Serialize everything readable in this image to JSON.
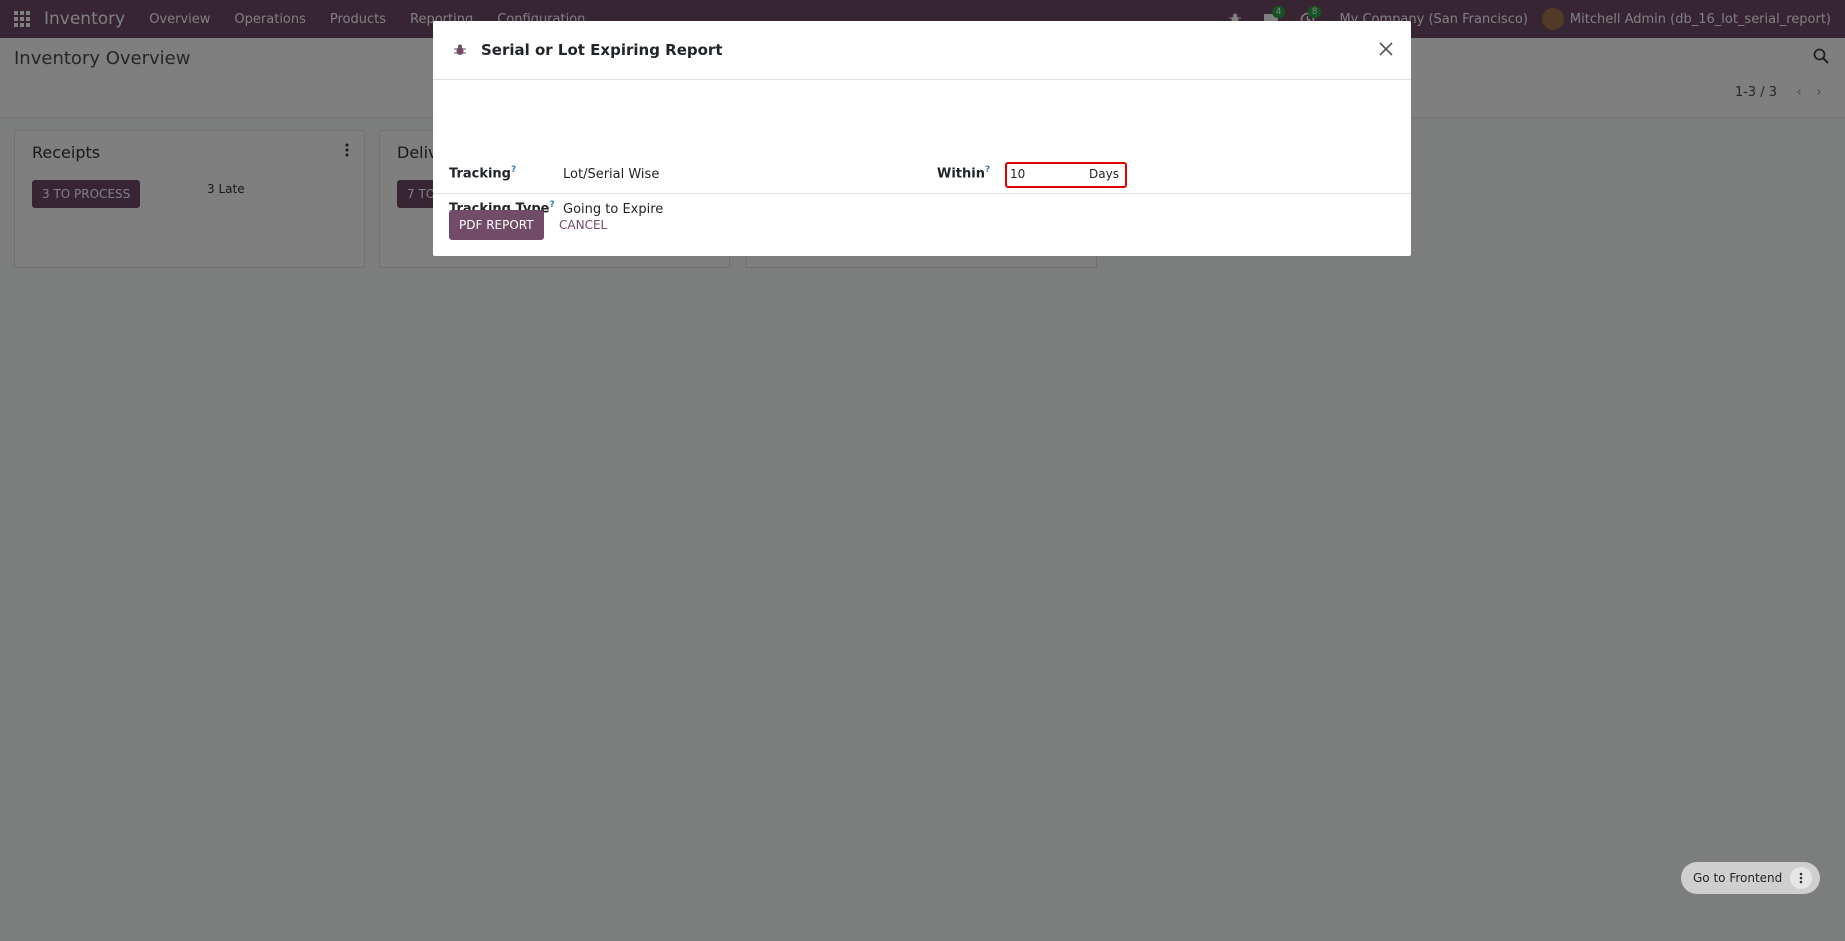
{
  "navbar": {
    "brand": "Inventory",
    "menu": [
      "Overview",
      "Operations",
      "Products",
      "Reporting",
      "Configuration"
    ],
    "messages_count": "4",
    "activities_count": "8",
    "company": "My Company (San Francisco)",
    "user": "Mitchell Admin (db_16_lot_serial_report)",
    "color": "#714b67"
  },
  "control_panel": {
    "title": "Inventory Overview",
    "pager": "1-3 / 3"
  },
  "cards": [
    {
      "title": "Receipts",
      "button": "3 TO PROCESS",
      "late": "3 Late"
    },
    {
      "title": "Deliv",
      "button": "7 TO"
    }
  ],
  "modal": {
    "title": "Serial or Lot Expiring Report",
    "tracking_label": "Tracking",
    "tracking_value": "Lot/Serial Wise",
    "tracking_type_label": "Tracking Type",
    "tracking_type_value": "Going to Expire",
    "within_label": "Within",
    "within_value": "10",
    "within_unit": "Days",
    "help_mark": "?",
    "pdf_button": "PDF REPORT",
    "cancel_button": "CANCEL"
  },
  "frontend": {
    "label": "Go to Frontend"
  }
}
